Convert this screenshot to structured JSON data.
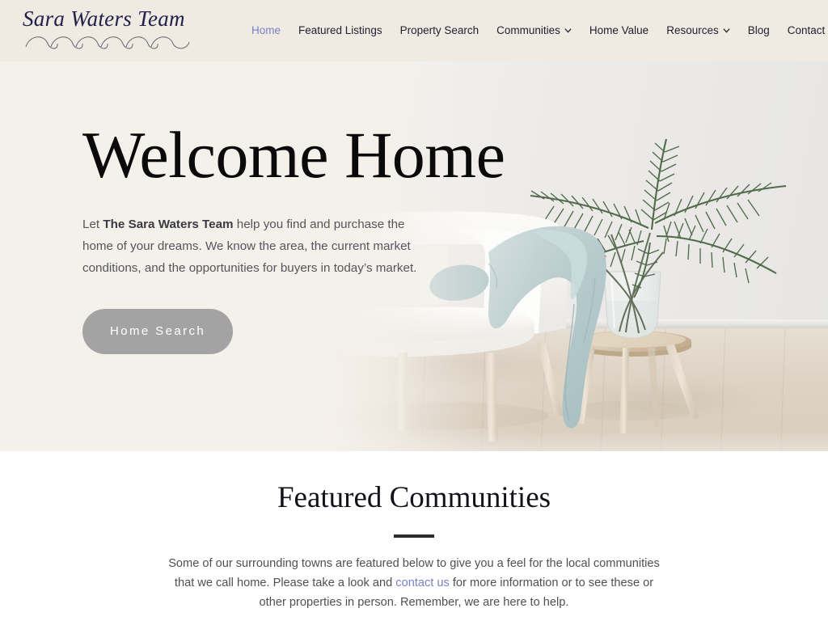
{
  "site": {
    "logo_text": "Sara Waters Team",
    "logo_wave_icon": "wave-flourish-icon"
  },
  "nav": {
    "items": [
      {
        "label": "Home",
        "active": true,
        "has_dropdown": false
      },
      {
        "label": "Featured Listings",
        "active": false,
        "has_dropdown": false
      },
      {
        "label": "Property Search",
        "active": false,
        "has_dropdown": false
      },
      {
        "label": "Communities",
        "active": false,
        "has_dropdown": true
      },
      {
        "label": "Home Value",
        "active": false,
        "has_dropdown": false
      },
      {
        "label": "Resources",
        "active": false,
        "has_dropdown": true
      },
      {
        "label": "Blog",
        "active": false,
        "has_dropdown": false
      },
      {
        "label": "Contact",
        "active": false,
        "has_dropdown": false
      }
    ],
    "dropdown_icon": "chevron-down-icon"
  },
  "hero": {
    "title": "Welcome Home",
    "paragraph_before": "Let ",
    "paragraph_bold": "The Sara Waters Team",
    "paragraph_after": " help you find and purchase the home of your dreams. We know the area, the current market conditions, and the opportunities for buyers in today’s market.",
    "cta_label": "Home Search",
    "cta_color": "#a3a3a3",
    "background_color": "#f4f0ea",
    "image_alt": "white armchair with sage throw blanket beside wooden side table holding a glass vase of palm fronds"
  },
  "featured": {
    "title": "Featured Communities",
    "body_before": "Some of our surrounding towns are featured below to give you a feel for the local communities that we call home. Please take a look and ",
    "body_link": "contact us",
    "body_after": " for more information or to see these or other properties in person. Remember, we are here to help."
  },
  "colors": {
    "header_bg": "#efebe3",
    "hero_bg": "#f4f0ea",
    "link": "#7b80c6",
    "logo": "#20204a",
    "heading": "#0a0a0a",
    "body_text": "#55555c",
    "divider": "#2b2b2b",
    "section_bg": "#ffffff"
  }
}
